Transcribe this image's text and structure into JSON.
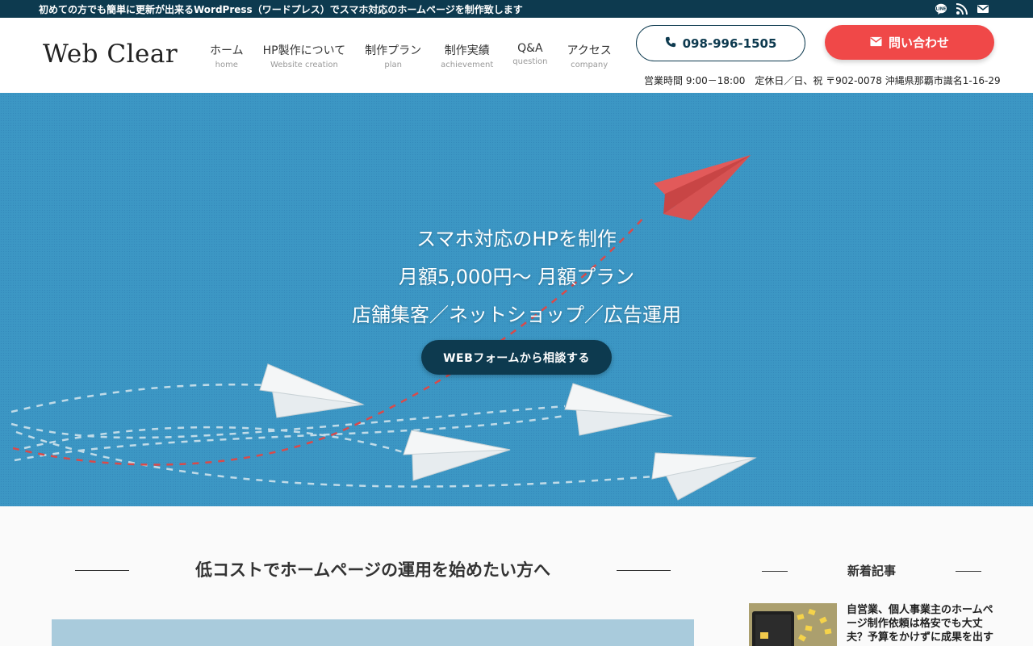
{
  "topbar": {
    "tagline": "初めての方でも簡単に更新が出来るWordPress（ワードプレス）でスマホ対応のホームページを制作致します",
    "icons": [
      "line-icon",
      "rss-icon",
      "mail-icon"
    ]
  },
  "header": {
    "logo": "Web Clear",
    "nav": [
      {
        "jp": "ホーム",
        "en": "home"
      },
      {
        "jp": "HP製作について",
        "en": "Website creation"
      },
      {
        "jp": "制作プラン",
        "en": "plan"
      },
      {
        "jp": "制作実績",
        "en": "achievement"
      },
      {
        "jp": "Q&A",
        "en": "question"
      },
      {
        "jp": "アクセス",
        "en": "company"
      }
    ],
    "tel": "098-996-1505",
    "contact_label": "問い合わせ",
    "info": "営業時間 9:00－18:00　定休日／日、祝 〒902-0078 沖縄県那覇市識名1-16-29"
  },
  "hero": {
    "line1": "スマホ対応のHPを制作",
    "line2": "月額5,000円〜 月額プラン",
    "line3": "店舗集客／ネットショップ／広告運用",
    "cta": "WEBフォームから相談する"
  },
  "main": {
    "section_title": "低コストでホームページの運用を始めたい方へ"
  },
  "sidebar": {
    "title": "新着記事",
    "articles": [
      {
        "title": "自営業、個人事業主のホームページ制作依頼は格安でも大丈夫？予算をかけずに成果を出す"
      }
    ]
  },
  "colors": {
    "navy": "#0d3a4f",
    "accent_red": "#f04848",
    "hero_blue": "#3c97c4"
  }
}
